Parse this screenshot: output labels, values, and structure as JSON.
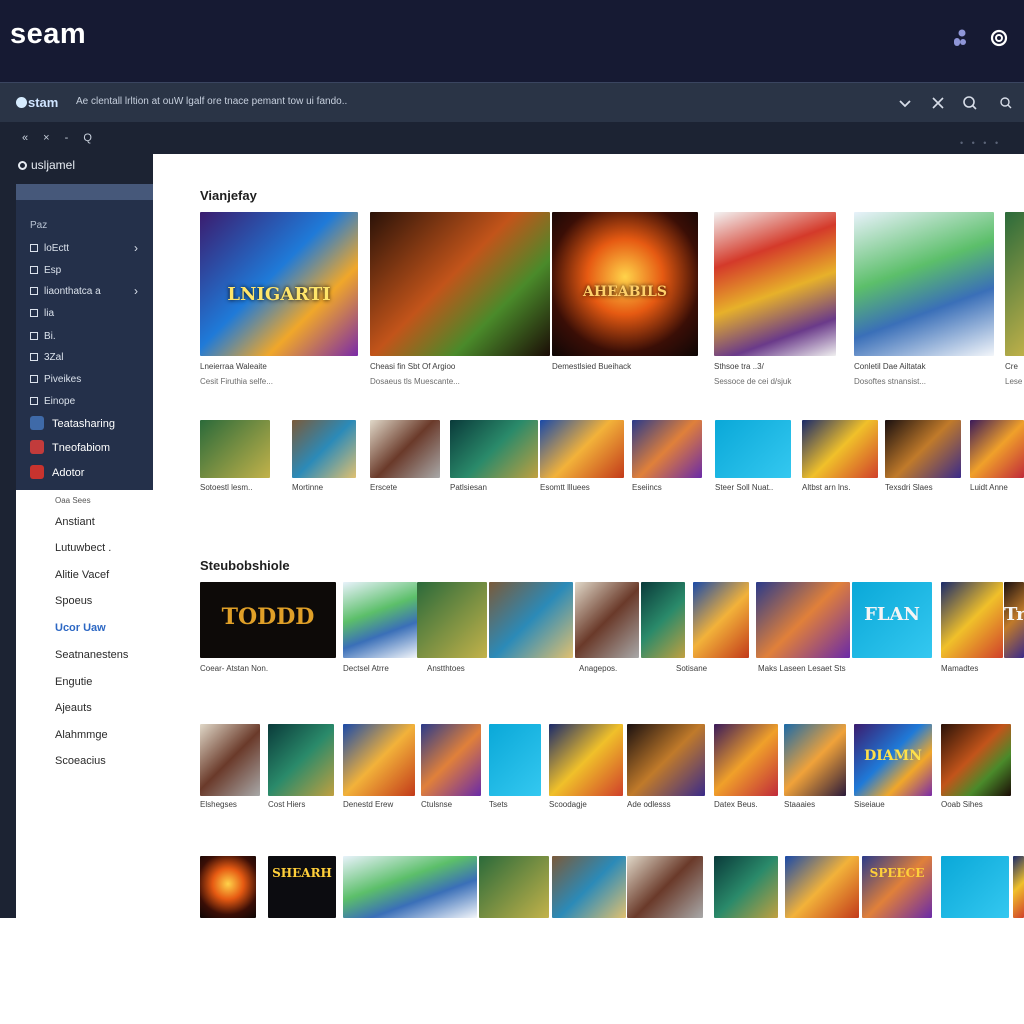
{
  "header": {
    "brand": "seam",
    "icons": [
      "user-icon",
      "refresh-icon"
    ]
  },
  "urlbar": {
    "logo": "stam",
    "address": "Ae clentall lrltion at ouW lgalf ore tnace pemant tow ui fando..",
    "controls": [
      "chevron-down-icon",
      "close-icon",
      "search-icon",
      "search-icon-small"
    ]
  },
  "nav": {
    "row": "« × - Q",
    "account": "usljamel",
    "tiny_links": "• • • •"
  },
  "sidebar": {
    "heading": "Paz",
    "items": [
      {
        "label": "loEctt",
        "chevron": true
      },
      {
        "label": "Esp",
        "chevron": false
      },
      {
        "label": "liaonthatca a",
        "chevron": true
      },
      {
        "label": "lia",
        "chevron": false
      },
      {
        "label": "Bi.",
        "chevron": false
      },
      {
        "label": "3Zal",
        "chevron": false
      },
      {
        "label": "Piveikes",
        "chevron": false
      },
      {
        "label": "Einope",
        "chevron": false
      }
    ],
    "featured": [
      {
        "label": "Teatasharing",
        "color": "#3f6aa8"
      },
      {
        "label": "Tneofabiom",
        "color": "#c23b3b"
      },
      {
        "label": "Adotor",
        "color": "#c8332e"
      }
    ],
    "categories_heading": "Oaa Sees",
    "categories": [
      {
        "label": "Anstiant",
        "active": false
      },
      {
        "label": "Lutuwbect .",
        "active": false
      },
      {
        "label": "Alitie Vacef",
        "active": false
      },
      {
        "label": "Spoeus",
        "active": false
      },
      {
        "label": "Ucor Uaw",
        "active": true
      },
      {
        "label": "Seatnanestens",
        "active": false
      },
      {
        "label": "Engutie",
        "active": false
      },
      {
        "label": "Ajeauts",
        "active": false
      },
      {
        "label": "Alahmmge",
        "active": false
      },
      {
        "label": "Scoeacius",
        "active": false
      }
    ]
  },
  "sections": [
    {
      "title": "Vianjefay",
      "featured": [
        {
          "label": "LNIGARTI",
          "title": "Lneierraa Waleaite",
          "sub": "Cesit Firuthia selfe..."
        },
        {
          "label": "",
          "title": "Cheasi fin Sbt Of Argioo",
          "sub": "Dosaeus tls Muescante..."
        },
        {
          "label": "AHEABILS",
          "title": "Demestlsied Bueihack",
          "sub": ""
        },
        {
          "label": "",
          "title": "Sthsoe tra ..3/",
          "sub": "Sessoce de cei d/sjuk"
        },
        {
          "label": "",
          "title": "Conletil Dae Ailtatak",
          "sub": "Dosoftes stnansist..."
        },
        {
          "label": "",
          "title": "Cre",
          "sub": "Lese"
        }
      ],
      "small": [
        "Sotoestl lesm..",
        "Mortinne",
        "Erscete",
        "Patlsiesan",
        "Esomtt llluees",
        "Eseiincs",
        "Steer Soll Nuat..",
        "Altbst arn lns.",
        "Texsdri Slaes",
        "Luidt Anne"
      ]
    },
    {
      "title": "Steubobshiole",
      "tiles_caption": [
        "Coear- Atstan Non.",
        "Dectsel Atrre",
        "Anstthtoes",
        "Anagepos.",
        "Sotisane",
        "Maks Laseen Lesaet Sts",
        "Mamadtes"
      ],
      "banner_labels": [
        "TODDD",
        "",
        "",
        "",
        "",
        "",
        "",
        "",
        "FLAN",
        "",
        "Trian"
      ]
    },
    {
      "captions": [
        "Elshegses",
        "Cost Hiers",
        "Denestd Erew",
        "Ctulsnse",
        "Tsets",
        "Scoodagje",
        "Ade odlesss",
        "Datex Beus.",
        "Staaaies",
        "Siseiaue",
        "Ooab Sihes"
      ],
      "labels": [
        "",
        "",
        "",
        "",
        "",
        "",
        "",
        "",
        "",
        "DIAMN",
        ""
      ]
    },
    {
      "labels": [
        "",
        "SHEARH",
        "",
        "",
        "",
        "",
        "",
        "",
        "SPEECE",
        "",
        ""
      ]
    }
  ],
  "colors": {
    "header": "#161a33",
    "urlbar": "#2a3446",
    "sidebar": "#24304a",
    "accent": "#2d68c4"
  }
}
